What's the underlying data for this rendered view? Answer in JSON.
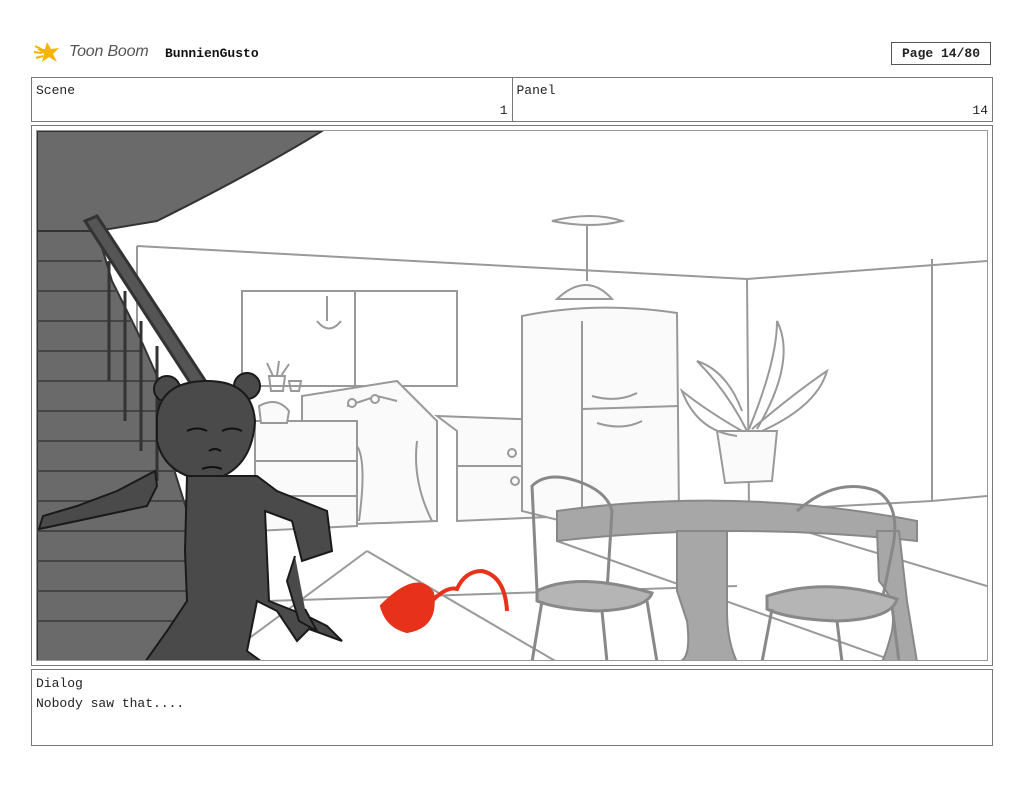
{
  "header": {
    "logo_text": "Toon Boom",
    "project_name": "BunnienGusto",
    "page_label": "Page 14/80"
  },
  "info": {
    "scene_label": "Scene",
    "scene_value": "1",
    "panel_label": "Panel",
    "panel_value": "14"
  },
  "dialog": {
    "label": "Dialog",
    "text": "Nobody saw that...."
  },
  "colors": {
    "accent": "#f4b400",
    "sketch_red": "#e8311a",
    "character_dark": "#4a4a4a"
  }
}
